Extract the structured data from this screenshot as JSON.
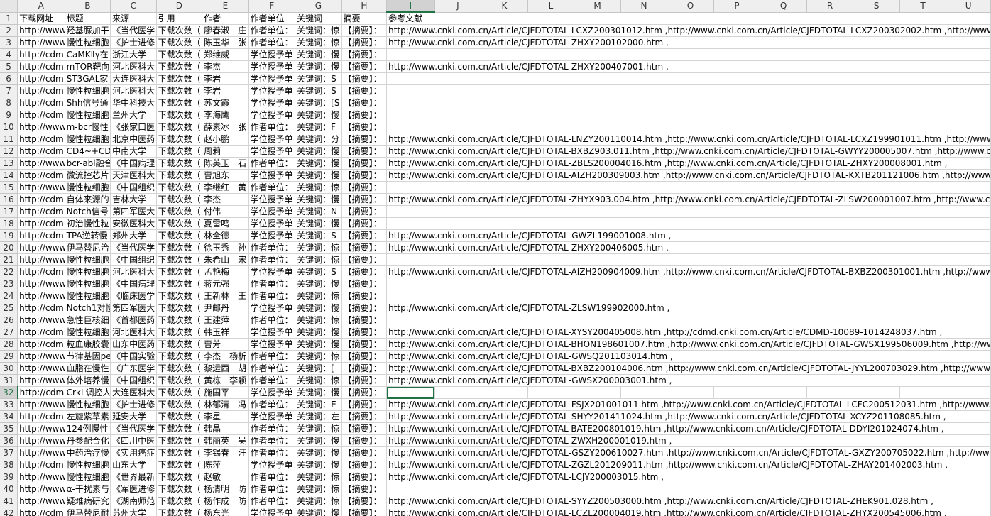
{
  "columns": [
    "A",
    "B",
    "C",
    "D",
    "E",
    "F",
    "G",
    "H",
    "I",
    "J",
    "K",
    "L",
    "M",
    "N",
    "O",
    "P",
    "Q",
    "R",
    "S",
    "T",
    "U"
  ],
  "selected_cell": {
    "row": 32,
    "col": "I"
  },
  "header_row": [
    "下载网址",
    "标题",
    "来源",
    "引用",
    "作者",
    "作者单位",
    "关键词",
    "摘要",
    "参考文献"
  ],
  "rows": [
    [
      "http://www",
      "羟基脲加干",
      "《当代医学",
      "下载次数（",
      "廖春淑　庄",
      "作者单位：",
      "关键词：惊",
      "【摘要】：",
      "http://www.cnki.com.cn/Article/CJFDTOTAL-LCXZ200301012.htm ,http://www.cnki.com.cn/Article/CJFDTOTAL-LCXZ200302002.htm ,http://www.cnki."
    ],
    [
      "http://www",
      "慢性粒细胞",
      "《护士进修",
      "下载次数（",
      "陈玉华　张",
      "作者单位：",
      "关键词：惊",
      "【摘要】：",
      "http://www.cnki.com.cn/Article/CJFDTOTAL-ZHXY200102000.htm ,"
    ],
    [
      "http://cdm",
      "CaMKⅡγ在",
      "浙江大学",
      "下载次数（",
      "郑维威",
      "学位授予单",
      "关键词：慢",
      "【摘要】：",
      ""
    ],
    [
      "http://cdm",
      "mTOR靶向",
      "河北医科大",
      "下载次数（",
      "李杰",
      "学位授予单",
      "关键词：慢",
      "【摘要】：",
      "http://www.cnki.com.cn/Article/CJFDTOTAL-ZHXY200407001.htm ,"
    ],
    [
      "http://cdm",
      "ST3GAL家",
      "大连医科大",
      "下载次数（",
      "李岩",
      "学位授予单",
      "关键词：S",
      "【摘要】：",
      ""
    ],
    [
      "http://cdm",
      "慢性粒细胞",
      "河北医科大",
      "下载次数（",
      "李岩",
      "学位授予单",
      "关键词：S",
      "【摘要】：",
      ""
    ],
    [
      "http://cdm",
      "Shh信号通",
      "华中科技大",
      "下载次数（",
      "苏文霞",
      "学位授予单",
      "关键词：[S",
      "【摘要】：",
      ""
    ],
    [
      "http://cdm",
      "慢性粒细胞",
      "兰州大学",
      "下载次数（",
      "李海鹰",
      "学位授予单",
      "关键词：慢",
      "【摘要】：",
      ""
    ],
    [
      "http://www",
      "m-bcr慢性",
      "《张家口医",
      "下载次数（",
      "薛素冰　张",
      "作者单位：",
      "关键词：F",
      "【摘要】：",
      ""
    ],
    [
      "http://cdm",
      "慢性粒细胞",
      "北京中医药",
      "下载次数（",
      "赵小鹏",
      "学位授予单",
      "关键词：分",
      "【摘要】：",
      "http://www.cnki.com.cn/Article/CJFDTOTAL-LNZY200110014.htm ,http://www.cnki.com.cn/Article/CJFDTOTAL-LCXZ199901011.htm ,http://www.cnki."
    ],
    [
      "http://cdm",
      "CD4~+CD2",
      "中南大学",
      "下载次数（",
      "周莉",
      "学位授予单",
      "关键词：慢",
      "【摘要】：",
      "http://www.cnki.com.cn/Article/CJFDTOTAL-BXBZ903.011.htm ,http://www.cnki.com.cn/Article/CJFDTOTAL-GWYY200005007.htm ,http://www.cnki.c"
    ],
    [
      "http://www",
      "bcr-abl融合",
      "《中国病理",
      "下载次数（",
      "陈英玉　石",
      "作者单位：",
      "关键词：慢",
      "【摘要】：",
      "http://www.cnki.com.cn/Article/CJFDTOTAL-ZBLS200004016.htm ,http://www.cnki.com.cn/Article/CJFDTOTAL-ZHXY200008001.htm ,"
    ],
    [
      "http://cdm",
      "微流控芯片",
      "天津医科大",
      "下载次数（",
      "曹旭东",
      "学位授予单",
      "关键词：慢",
      "【摘要】：",
      "http://www.cnki.com.cn/Article/CJFDTOTAL-AIZH200309003.htm ,http://www.cnki.com.cn/Article/CJFDTOTAL-KXTB201121006.htm ,http://www.cnki."
    ],
    [
      "http://www",
      "慢性粒细胞",
      "《中国组织",
      "下载次数（",
      "李继红　黄",
      "作者单位：",
      "关键词：惊",
      "【摘要】：",
      ""
    ],
    [
      "http://cdm",
      "自体来源的",
      "吉林大学",
      "下载次数（",
      "李杰",
      "学位授予单",
      "关键词：慢",
      "【摘要】：",
      "http://www.cnki.com.cn/Article/CJFDTOTAL-ZHYX903.004.htm ,http://www.cnki.com.cn/Article/CJFDTOTAL-ZLSW200001007.htm ,http://www.cnki.co"
    ],
    [
      "http://cdm",
      "Notch信号",
      "第四军医大",
      "下载次数（",
      "付伟",
      "学位授予单",
      "关键词：N",
      "【摘要】：",
      ""
    ],
    [
      "http://cdm",
      "初治慢性粒",
      "安徽医科大",
      "下载次数（",
      "夏雷鸣",
      "学位授予单",
      "关键词：慢",
      "【摘要】：",
      ""
    ],
    [
      "http://cdm",
      "TPA逆转慢",
      "郑州大学",
      "下载次数（",
      "林全德",
      "学位授予单",
      "关键词：S",
      "【摘要】：",
      "http://www.cnki.com.cn/Article/CJFDTOTAL-GWZL199001008.htm ,"
    ],
    [
      "http://www",
      "伊马替尼治",
      "《当代医学",
      "下载次数（",
      "徐玉秀　孙",
      "作者单位：",
      "关键词：惊",
      "【摘要】：",
      "http://www.cnki.com.cn/Article/CJFDTOTAL-ZHXY200406005.htm ,"
    ],
    [
      "http://www",
      "慢性粒细胞",
      "《中国组织",
      "下载次数（",
      "朱希山　宋",
      "作者单位：",
      "关键词：惊",
      "【摘要】：",
      ""
    ],
    [
      "http://cdm",
      "慢性粒细胞",
      "河北医科大",
      "下载次数（",
      "孟艳梅",
      "学位授予单",
      "关键词：S",
      "【摘要】：",
      "http://www.cnki.com.cn/Article/CJFDTOTAL-AIZH200904009.htm ,http://www.cnki.com.cn/Article/CJFDTOTAL-BXBZ200301001.htm ,http://www.cnki."
    ],
    [
      "http://www",
      "慢性粒细胞",
      "《中国病理",
      "下载次数（",
      "蒋元强",
      "作者单位：",
      "关键词：慢",
      "【摘要】：",
      ""
    ],
    [
      "http://www",
      "慢性粒细胞",
      "《临床医学",
      "下载次数（",
      "王新林　王",
      "作者单位：",
      "关键词：惊",
      "【摘要】：",
      ""
    ],
    [
      "http://cdm",
      "Notch1对慢",
      "第四军医大",
      "下载次数（",
      "尹邮丹",
      "学位授予单",
      "关键词：慢",
      "【摘要】：",
      "http://www.cnki.com.cn/Article/CJFDTOTAL-ZLSW199902000.htm ,"
    ],
    [
      "http://www",
      "急性巨核细",
      "《首都医药",
      "下载次数（",
      "王建萍",
      "作者单位：",
      "关键词：惊",
      "【摘要】：",
      ""
    ],
    [
      "http://cdm",
      "慢性粒细胞",
      "河北医科大",
      "下载次数（",
      "韩玉祥",
      "学位授予单",
      "关键词：慢",
      "【摘要】：",
      "http://www.cnki.com.cn/Article/CJFDTOTAL-XYSY200405008.htm ,http://cdmd.cnki.com.cn/Article/CDMD-10089-1014248037.htm ,"
    ],
    [
      "http://cdm",
      "粒血康胶囊",
      "山东中医药",
      "下载次数（",
      "曹芳",
      "学位授予单",
      "关键词：慢",
      "【摘要】：",
      "http://www.cnki.com.cn/Article/CJFDTOTAL-BHON198601007.htm ,http://www.cnki.com.cn/Article/CJFDTOTAL-GWSX199506009.htm ,http://www.cn"
    ],
    [
      "http://www",
      "节律基因pe",
      "《中国实验",
      "下载次数（",
      "李杰　杨析",
      "作者单位：",
      "关键词：惊",
      "【摘要】：",
      "http://www.cnki.com.cn/Article/CJFDTOTAL-GWSQ201103014.htm ,"
    ],
    [
      "http://www",
      "血脂在慢性",
      "《广东医学",
      "下载次数（",
      "黎运西　胡",
      "作者单位：",
      "关键词：[",
      "【摘要】：",
      "http://www.cnki.com.cn/Article/CJFDTOTAL-BXBZ200104006.htm ,http://www.cnki.com.cn/Article/CJFDTOTAL-JYYL200703029.htm ,http://www.cnki"
    ],
    [
      "http://www",
      "体外培养慢",
      "《中国组织",
      "下载次数（",
      "黄栋　李颖",
      "作者单位：",
      "关键词：惊",
      "【摘要】：",
      "http://www.cnki.com.cn/Article/CJFDTOTAL-GWSX200003001.htm ,"
    ],
    [
      "http://cdm",
      "CrkL调控人",
      "大连医科大",
      "下载次数（",
      "施国平",
      "学位授予单",
      "关键词：慢",
      "【摘要】：",
      ""
    ],
    [
      "http://www",
      "慢性粒细胞",
      "《护士进修",
      "下载次数（",
      "林郁清　冯",
      "作者单位：",
      "关键词：E",
      "【摘要】：",
      "http://www.cnki.com.cn/Article/CJFDTOTAL-FSJX201001011.htm ,http://www.cnki.com.cn/Article/CJFDTOTAL-LCFC200512031.htm ,http://www.cnki."
    ],
    [
      "http://cdm",
      "左旋紫草素",
      "延安大学",
      "下载次数（",
      "李星",
      "学位授予单",
      "关键词：左",
      "【摘要】：",
      "http://www.cnki.com.cn/Article/CJFDTOTAL-SHYY201411024.htm ,http://www.cnki.com.cn/Article/CJFDTOTAL-XCYZ201108085.htm ,"
    ],
    [
      "http://www",
      "124例慢性",
      "《当代医学",
      "下载次数（",
      "韩晶",
      "作者单位：",
      "关键词：惊",
      "【摘要】：",
      "http://www.cnki.com.cn/Article/CJFDTOTAL-BATE200801019.htm ,http://www.cnki.com.cn/Article/CJFDTOTAL-DDYI201024074.htm ,"
    ],
    [
      "http://www",
      "丹参配合化",
      "《四川中医",
      "下载次数（",
      "韩丽英　吴",
      "作者单位：",
      "关键词：慢",
      "【摘要】：",
      "http://www.cnki.com.cn/Article/CJFDTOTAL-ZWXH200001019.htm ,"
    ],
    [
      "http://www",
      "中药治疗慢",
      "《实用癌症",
      "下载次数（",
      "李锡春　汪",
      "作者单位：",
      "关键词：慢",
      "【摘要】：",
      "http://www.cnki.com.cn/Article/CJFDTOTAL-GSZY200610027.htm ,http://www.cnki.com.cn/Article/CJFDTOTAL-GXZY200705022.htm ,http://www.cnk"
    ],
    [
      "http://cdm",
      "慢性粒细胞",
      "山东大学",
      "下载次数（",
      "陈萍",
      "学位授予单",
      "关键词：慢",
      "【摘要】：",
      "http://www.cnki.com.cn/Article/CJFDTOTAL-ZGZL201209011.htm ,http://www.cnki.com.cn/Article/CJFDTOTAL-ZHAY201402003.htm ,"
    ],
    [
      "http://www",
      "慢性粒细胞",
      "《世界最新",
      "下载次数（",
      "赵敏",
      "作者单位：",
      "关键词：惊",
      "【摘要】：",
      "http://www.cnki.com.cn/Article/CJFDTOTAL-LCJY200003015.htm ,"
    ],
    [
      "http://www",
      "α-干扰素与",
      "《军医进修",
      "下载次数（",
      "杨清明　防",
      "作者单位：",
      "关键词：惊",
      "【摘要】：",
      ""
    ],
    [
      "http://www",
      "疑难病研究",
      "《湖南师范",
      "下载次数（",
      "杨作成　防",
      "作者单位：",
      "关键词：惊",
      "【摘要】：",
      "http://www.cnki.com.cn/Article/CJFDTOTAL-SYYZ200503000.htm ,http://www.cnki.com.cn/Article/CJFDTOTAL-ZHEK901.028.htm ,"
    ],
    [
      "http://cdm",
      "伊马替尼耐",
      "苏州大学",
      "下载次数（",
      "杨东光",
      "学位授予单",
      "关键词：慢",
      "【摘要】：",
      "http://www.cnki.com.cn/Article/CJFDTOTAL-LCZL200004019.htm ,http://www.cnki.com.cn/Article/CJFDTOTAL-ZHYX200545006.htm ,"
    ]
  ]
}
